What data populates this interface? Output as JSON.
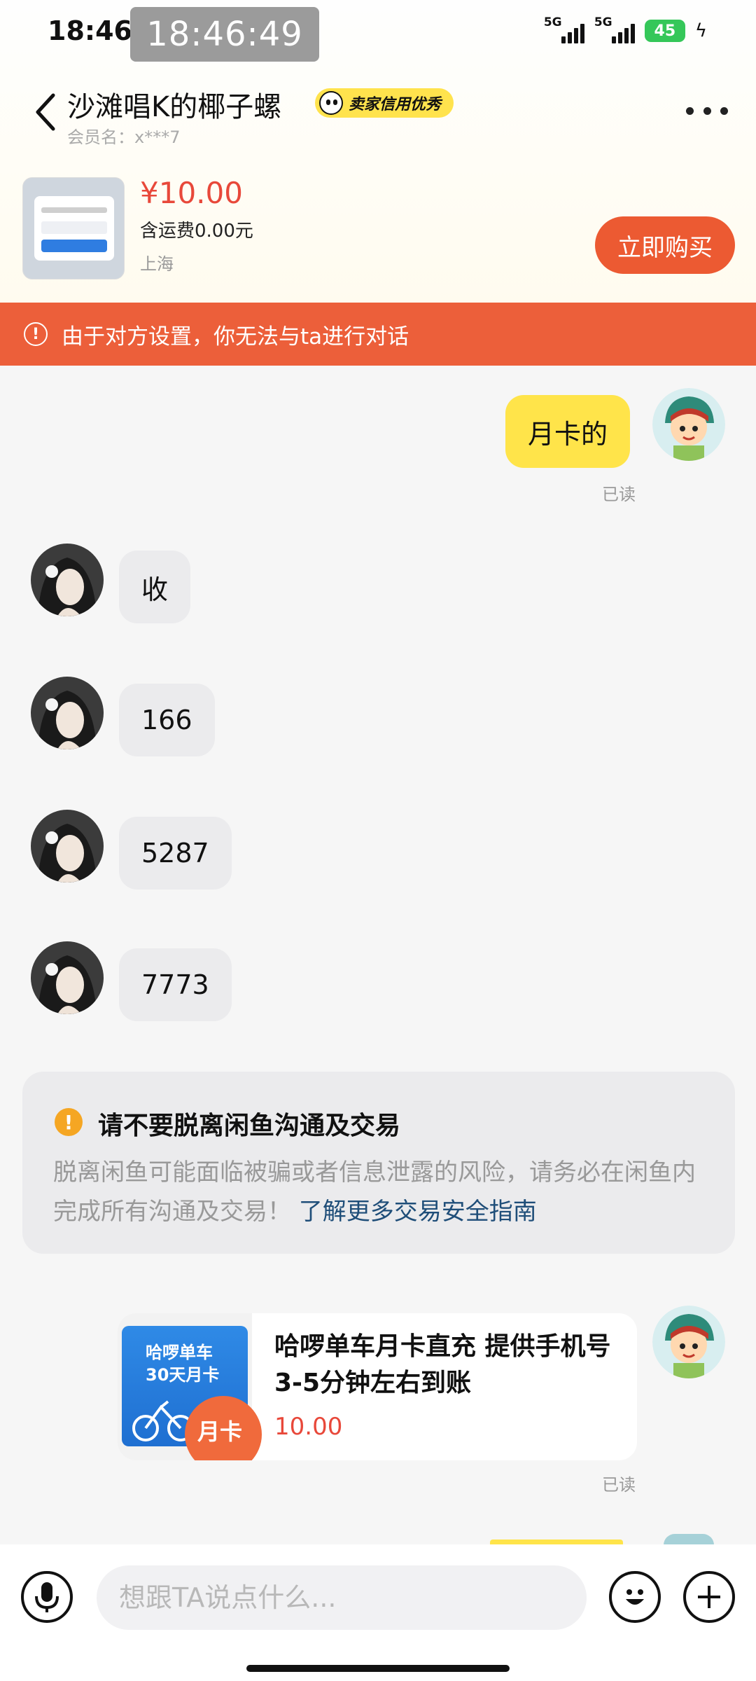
{
  "status_bar": {
    "time": "18:46",
    "clock_overlay": "18:46:49",
    "network_1": "5G",
    "network_2": "5G",
    "battery": "45"
  },
  "header": {
    "title": "沙滩唱K的椰子螺",
    "badge": "卖家信用优秀",
    "member": "会员名：x***7"
  },
  "product": {
    "price": "¥10.00",
    "shipping": "含运费0.00元",
    "location": "上海",
    "buy_label": "立即购买"
  },
  "warning": {
    "text": "由于对方设置，你无法与ta进行对话"
  },
  "messages": [
    {
      "side": "me",
      "text": "月卡的",
      "status": "已读"
    },
    {
      "side": "other",
      "text": "收"
    },
    {
      "side": "other",
      "text": "166"
    },
    {
      "side": "other",
      "text": "5287"
    },
    {
      "side": "other",
      "text": "7773"
    }
  ],
  "notice": {
    "title": "请不要脱离闲鱼沟通及交易",
    "body": "脱离闲鱼可能面临被骗或者信息泄露的风险，请务必在闲鱼内完成所有沟通及交易！",
    "link": "了解更多交易安全指南"
  },
  "share_card": {
    "image_line1": "哈啰单车",
    "image_line2": "30天月卡",
    "image_badge": "月卡",
    "title": "哈啰单车月卡直充 提供手机号3-5分钟左右到账",
    "price": "10.00",
    "status": "已读"
  },
  "input": {
    "placeholder": "想跟TA说点什么..."
  },
  "colors": {
    "accent_orange": "#ec5a32",
    "price_red": "#e8483a",
    "my_bubble": "#ffe44a",
    "badge_yellow": "#ffe34d",
    "battery_green": "#35c759"
  }
}
